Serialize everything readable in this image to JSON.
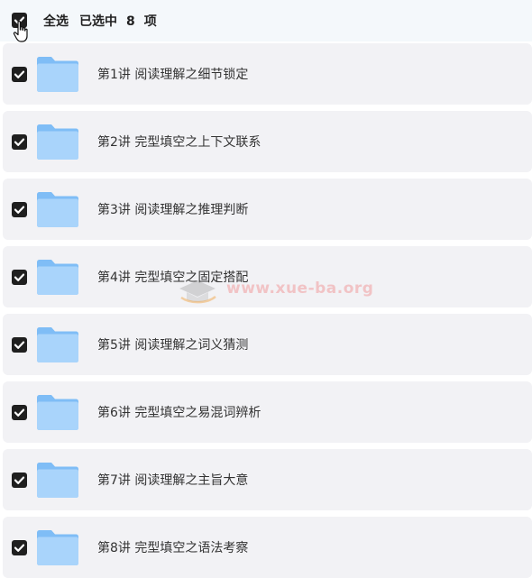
{
  "header": {
    "select_all_label": "全选",
    "selected_prefix": "已选中",
    "selected_count": "8",
    "selected_suffix": "项"
  },
  "items": [
    {
      "label": "第1讲 阅读理解之细节锁定",
      "checked": true,
      "icon": "folder-icon"
    },
    {
      "label": "第2讲 完型填空之上下文联系",
      "checked": true,
      "icon": "folder-icon"
    },
    {
      "label": "第3讲 阅读理解之推理判断",
      "checked": true,
      "icon": "folder-icon"
    },
    {
      "label": "第4讲 完型填空之固定搭配",
      "checked": true,
      "icon": "folder-icon"
    },
    {
      "label": "第5讲 阅读理解之词义猜测",
      "checked": true,
      "icon": "folder-icon"
    },
    {
      "label": "第6讲 完型填空之易混词辨析",
      "checked": true,
      "icon": "folder-icon"
    },
    {
      "label": "第7讲 阅读理解之主旨大意",
      "checked": true,
      "icon": "folder-icon"
    },
    {
      "label": "第8讲 完型填空之语法考察",
      "checked": true,
      "icon": "folder-icon"
    }
  ],
  "watermark": {
    "text": "www.xue-ba.org"
  },
  "colors": {
    "checkbox": "#1f1f1f",
    "row_background": "#f2f2f5",
    "folder_light": "#a9d4fb",
    "folder_dark": "#7fbdf6"
  }
}
